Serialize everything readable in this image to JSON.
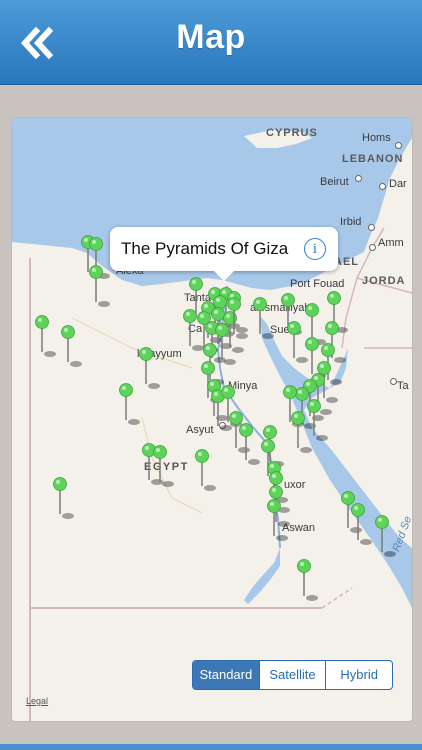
{
  "header": {
    "title": "Map",
    "back_icon": "double-chevron-left-icon"
  },
  "map": {
    "callout": {
      "title": "The Pyramids Of Giza",
      "info_icon": "info-icon"
    },
    "labels": {
      "cyprus": "CYPRUS",
      "homs": "Homs",
      "lebanon": "LEBANON",
      "beirut": "Beirut",
      "dar": "Dar",
      "irbid": "Irbid",
      "amm": "Amm",
      "ael": "AEL",
      "jordan": "JORDA",
      "alexandria": "Alexa",
      "port_fouad": "Port Fouad",
      "tanta": "Tanta",
      "ismailia": "al Ismailiyah",
      "suez": "Sue",
      "fayyum": "l Fayyum",
      "minya": "Minya",
      "asyut": "Asyut",
      "egypt": "EGYPT",
      "luxor": "uxor",
      "aswan": "Aswan",
      "red_sea": "Red Se",
      "ta": "Ta",
      "ca": "Ca"
    },
    "pin_color": "#5ed35a",
    "water_color": "#a8c8ea",
    "land_color": "#f4f1eb"
  },
  "map_type": {
    "options": [
      "Standard",
      "Satellite",
      "Hybrid"
    ],
    "selected": "Standard"
  },
  "legal": "Legal",
  "colors": {
    "navbar": "#2f80c6",
    "accent": "#2a6db3"
  }
}
